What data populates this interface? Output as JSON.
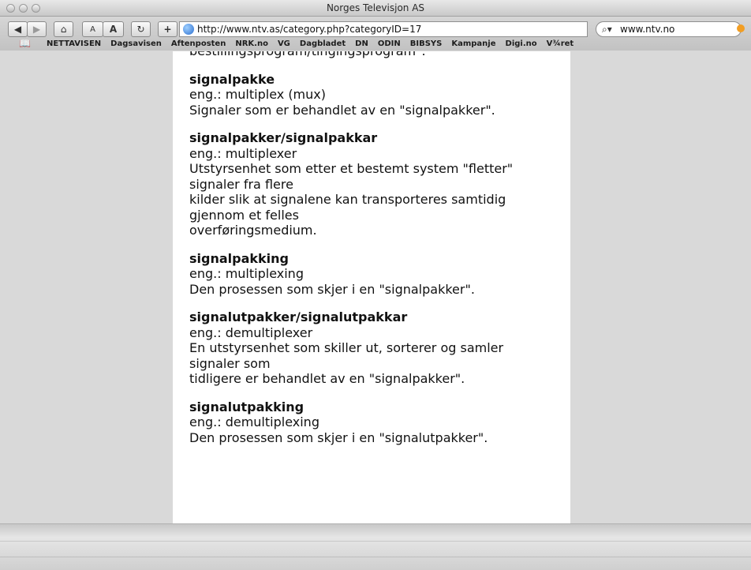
{
  "window": {
    "title": "Norges Televisjon AS"
  },
  "toolbar": {
    "back_icon": "back-arrow-icon",
    "forward_icon": "forward-arrow-icon",
    "home_icon": "home-icon",
    "smaller_text": "A",
    "larger_text": "A",
    "reload_icon": "reload-icon",
    "add_bookmark": "+",
    "url": "http://www.ntv.as/category.php?categoryID=17",
    "search_value": "www.ntv.no"
  },
  "bookmarks": [
    "NETTAVISEN",
    "Dagsavisen",
    "Aftenposten",
    "NRK.no",
    "VG",
    "Dagbladet",
    "DN",
    "ODIN",
    "BIBSYS",
    "Kampanje",
    "Digi.no",
    "V¾ret"
  ],
  "content": {
    "top_partial": "bestillingsprogram/tingingsprogram\".",
    "entries": [
      {
        "term": "signalpakke",
        "lines": [
          "eng.: multiplex (mux)",
          "Signaler som er behandlet av en \"signalpakker\"."
        ]
      },
      {
        "term": "signalpakker/signalpakkar",
        "lines": [
          "eng.: multiplexer",
          "Utstyrsenhet som etter et bestemt system \"fletter\"",
          "signaler fra flere",
          "kilder slik at signalene kan transporteres samtidig",
          "gjennom et felles",
          "overføringsmedium."
        ]
      },
      {
        "term": "signalpakking",
        "lines": [
          "eng.: multiplexing",
          "Den prosessen som skjer i en \"signalpakker\"."
        ]
      },
      {
        "term": "signalutpakker/signalutpakkar",
        "lines": [
          "eng.: demultiplexer",
          "En utstyrsenhet som skiller ut, sorterer og samler",
          "signaler som",
          "tidligere er behandlet av en \"signalpakker\"."
        ]
      },
      {
        "term": "signalutpakking",
        "lines": [
          "eng.: demultiplexing",
          "Den prosessen som skjer i en \"signalutpakker\"."
        ]
      }
    ]
  }
}
